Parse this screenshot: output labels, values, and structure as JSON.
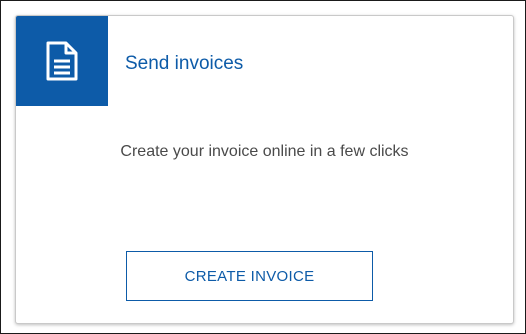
{
  "card": {
    "title": "Send invoices",
    "description": "Create your invoice online in a few clicks",
    "button_label": "CREATE INVOICE",
    "icon": "document-icon"
  },
  "colors": {
    "accent": "#0d5ba8",
    "text": "#4a4a4a",
    "border": "#c9c9c9"
  }
}
